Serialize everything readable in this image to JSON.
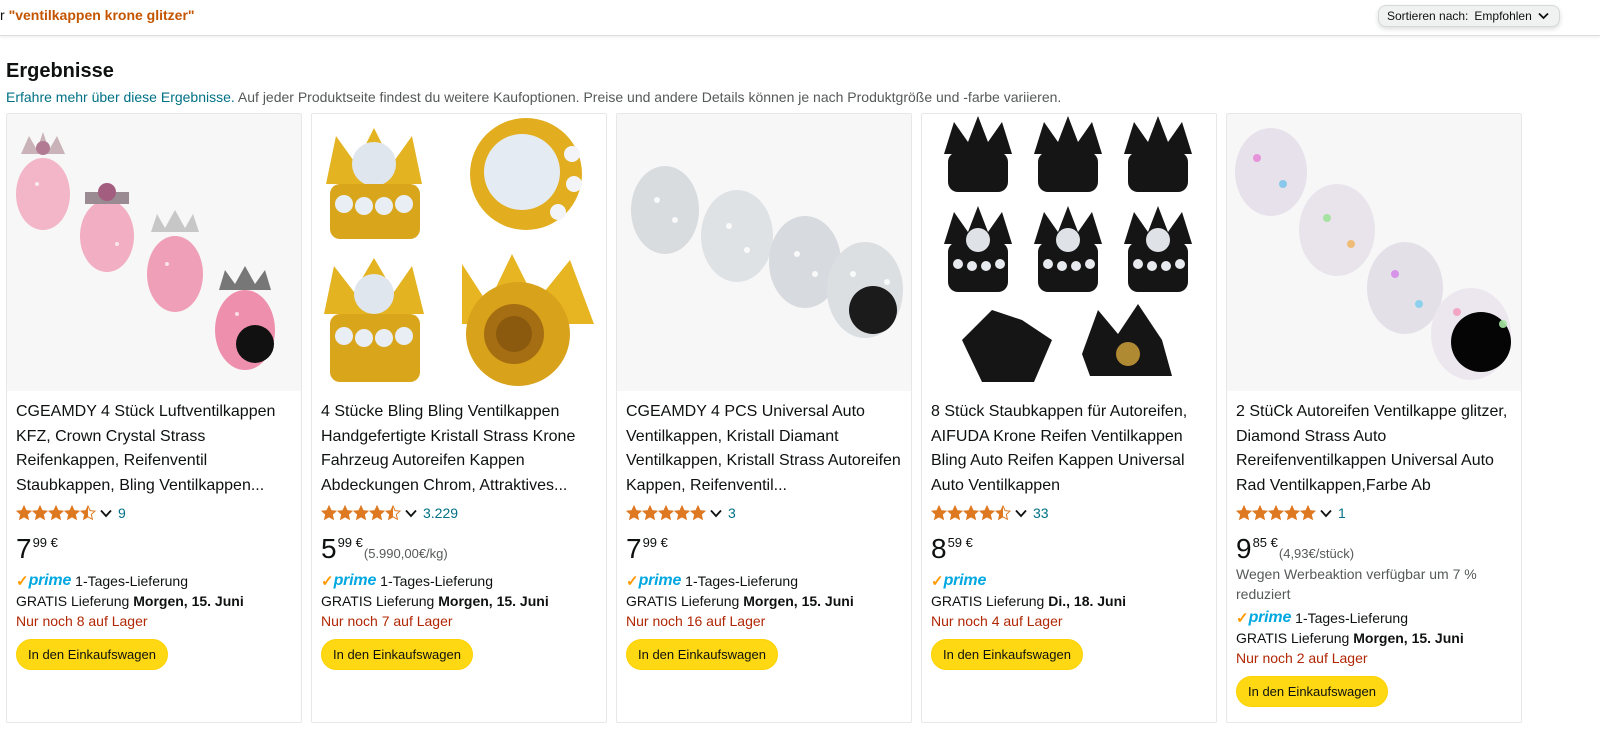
{
  "search": {
    "prefix": "r ",
    "query": "\"ventilkappen krone glitzer\""
  },
  "sort": {
    "label": "Sortieren nach:",
    "value": "Empfohlen"
  },
  "results": {
    "title": "Ergebnisse",
    "learn_more": "Erfahre mehr über diese Ergebnisse.",
    "note": " Auf jeder Produktseite findest du weitere Kaufoptionen. Preise und andere Details können je nach Produktgröße und -farbe variieren."
  },
  "colors": {
    "accent_link": "#007185",
    "price_stock": "#b12704",
    "cart_button": "#ffd814",
    "star": "#de7921",
    "prime_blue": "#00a8e1",
    "prime_check": "#ff9900",
    "query": "#c45500"
  },
  "products": [
    {
      "image": "pink-crystal-crown-valve-caps",
      "title": "CGEAMDY 4 Stück Luftventilkappen KFZ, Crown Crystal Strass Reifenkappen, Reifenventil Staubkappen, Bling Ventilkappen...",
      "rating": 4.5,
      "rating_count": "9",
      "price_whole": "7",
      "price_fraction": "99 €",
      "unit_price": "",
      "promo": "",
      "prime_delivery": "1-Tages-Lieferung",
      "delivery_prefix": "GRATIS Lieferung ",
      "delivery_date": "Morgen, 15. Juni",
      "stock": "Nur noch 8 auf Lager",
      "cart": "In den Einkaufswagen"
    },
    {
      "image": "gold-crown-crystal-valve-caps",
      "title": "4 Stücke Bling Bling Ventilkappen Handgefertigte Kristall Strass Krone Fahrzeug Autoreifen Kappen Abdeckungen Chrom, Attraktives...",
      "rating": 4.5,
      "rating_count": "3.229",
      "price_whole": "5",
      "price_fraction": "99 €",
      "unit_price": "(5.990,00€/kg)",
      "promo": "",
      "prime_delivery": "1-Tages-Lieferung",
      "delivery_prefix": "GRATIS Lieferung ",
      "delivery_date": "Morgen, 15. Juni",
      "stock": "Nur noch 7 auf Lager",
      "cart": "In den Einkaufswagen"
    },
    {
      "image": "silver-rhinestone-valve-caps",
      "title": "CGEAMDY 4 PCS Universal Auto Ventilkappen, Kristall Diamant Ventilkappen, Kristall Strass Autoreifen Kappen, Reifenventil...",
      "rating": 5,
      "rating_count": "3",
      "price_whole": "7",
      "price_fraction": "99 €",
      "unit_price": "",
      "promo": "",
      "prime_delivery": "1-Tages-Lieferung",
      "delivery_prefix": "GRATIS Lieferung ",
      "delivery_date": "Morgen, 15. Juni",
      "stock": "Nur noch 16 auf Lager",
      "cart": "In den Einkaufswagen"
    },
    {
      "image": "black-crown-valve-caps",
      "title": "8 Stück Staubkappen für Autoreifen, AIFUDA Krone Reifen Ventilkappen Bling Auto Reifen Kappen Universal Auto Ventilkappen",
      "rating": 4.5,
      "rating_count": "33",
      "price_whole": "8",
      "price_fraction": "59 €",
      "unit_price": "",
      "promo": "",
      "prime_delivery": "",
      "delivery_prefix": "GRATIS Lieferung ",
      "delivery_date": "Di., 18. Juni",
      "stock": "Nur noch 4 auf Lager",
      "cart": "In den Einkaufswagen"
    },
    {
      "image": "iridescent-diamond-valve-caps",
      "title": "2 StüCk Autoreifen Ventilkappe glitzer, Diamond Strass Auto Rereifenventilkappen Universal Auto Rad Ventilkappen,Farbe Ab",
      "rating": 5,
      "rating_count": "1",
      "price_whole": "9",
      "price_fraction": "85 €",
      "unit_price": "(4,93€/stück)",
      "promo": "Wegen Werbeaktion verfügbar um 7 % reduziert",
      "prime_delivery": "1-Tages-Lieferung",
      "delivery_prefix": "GRATIS Lieferung ",
      "delivery_date": "Morgen, 15. Juni",
      "stock": "Nur noch 2 auf Lager",
      "cart": "In den Einkaufswagen"
    }
  ]
}
